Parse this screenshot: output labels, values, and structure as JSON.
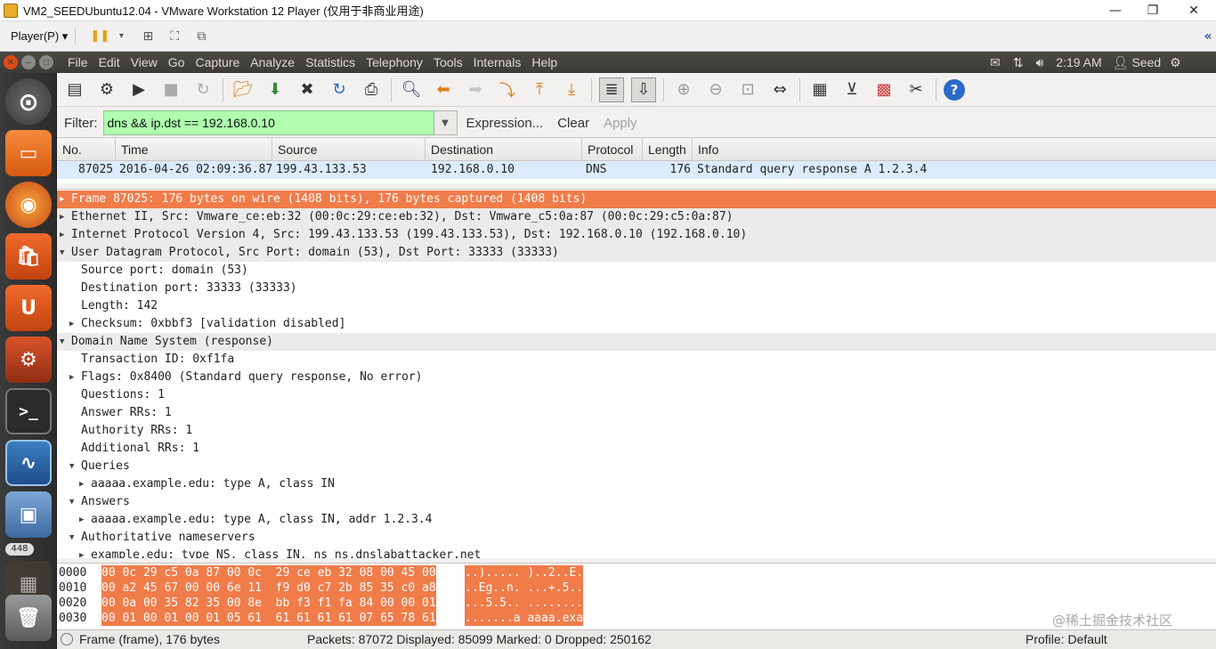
{
  "host_window": {
    "title": "VM2_SEEDUbuntu12.04 - VMware Workstation 12 Player (仅用于非商业用途)",
    "minimize": "—",
    "restore": "❐",
    "close": "✕"
  },
  "vmware_toolbar": {
    "player_menu": "Player(P) ▾",
    "pause_icon": "❚❚",
    "collapse_icon": "«"
  },
  "ubuntu_panel": {
    "menus": [
      "File",
      "Edit",
      "View",
      "Go",
      "Capture",
      "Analyze",
      "Statistics",
      "Telephony",
      "Tools",
      "Internals",
      "Help"
    ],
    "time": "2:19 AM",
    "user": "Seed"
  },
  "launcher": {
    "badge": "448"
  },
  "filter": {
    "label": "Filter:",
    "value": "dns && ip.dst == 192.168.0.10",
    "expression": "Expression...",
    "clear": "Clear",
    "apply": "Apply"
  },
  "packet_list": {
    "columns": [
      "No.",
      "Time",
      "Source",
      "Destination",
      "Protocol",
      "Length",
      "Info"
    ],
    "row": {
      "no": "87025",
      "time": "2016-04-26 02:09:36.87",
      "source": "199.43.133.53",
      "destination": "192.168.0.10",
      "protocol": "DNS",
      "length": "176",
      "info": "Standard query response A 1.2.3.4"
    }
  },
  "details": [
    {
      "text": "Frame 87025: 176 bytes on wire (1408 bits), 176 bytes captured (1408 bits)",
      "arrow": "▶"
    },
    {
      "text": "Ethernet II, Src: Vmware_ce:eb:32 (00:0c:29:ce:eb:32), Dst: Vmware_c5:0a:87 (00:0c:29:c5:0a:87)",
      "arrow": "▶"
    },
    {
      "text": "Internet Protocol Version 4, Src: 199.43.133.53 (199.43.133.53), Dst: 192.168.0.10 (192.168.0.10)",
      "arrow": "▶"
    },
    {
      "text": "User Datagram Protocol, Src Port: domain (53), Dst Port: 33333 (33333)",
      "arrow": "▼"
    },
    {
      "text": "Source port: domain (53)",
      "arrow": ""
    },
    {
      "text": "Destination port: 33333 (33333)",
      "arrow": ""
    },
    {
      "text": "Length: 142",
      "arrow": ""
    },
    {
      "text": "Checksum: 0xbbf3 [validation disabled]",
      "arrow": "▶"
    },
    {
      "text": "Domain Name System (response)",
      "arrow": "▼"
    },
    {
      "text": "Transaction ID: 0xf1fa",
      "arrow": ""
    },
    {
      "text": "Flags: 0x8400 (Standard query response, No error)",
      "arrow": "▶"
    },
    {
      "text": "Questions: 1",
      "arrow": ""
    },
    {
      "text": "Answer RRs: 1",
      "arrow": ""
    },
    {
      "text": "Authority RRs: 1",
      "arrow": ""
    },
    {
      "text": "Additional RRs: 1",
      "arrow": ""
    },
    {
      "text": "Queries",
      "arrow": "▼"
    },
    {
      "text": "aaaaa.example.edu: type A, class IN",
      "arrow": "▶"
    },
    {
      "text": "Answers",
      "arrow": "▼"
    },
    {
      "text": "aaaaa.example.edu: type A, class IN, addr 1.2.3.4",
      "arrow": "▶"
    },
    {
      "text": "Authoritative nameservers",
      "arrow": "▼"
    },
    {
      "text": "example.edu: type NS, class IN, ns ns.dnslabattacker.net",
      "arrow": "▶"
    }
  ],
  "bytes": [
    {
      "offset": "0000",
      "hex": "00 0c 29 c5 0a 87 00 0c  29 ce eb 32 08 00 45 00",
      "ascii": "..)..... )..2..E."
    },
    {
      "offset": "0010",
      "hex": "00 a2 45 67 00 00 6e 11  f9 d0 c7 2b 85 35 c0 a8",
      "ascii": "..Eg..n. ...+.5.."
    },
    {
      "offset": "0020",
      "hex": "00 0a 00 35 82 35 00 8e  bb f3 f1 fa 84 00 00 01",
      "ascii": "...5.5.. ........"
    },
    {
      "offset": "0030",
      "hex": "00 01 00 01 00 01 05 61  61 61 61 61 07 65 78 61",
      "ascii": ".......a aaaa.exa"
    }
  ],
  "statusbar": {
    "frame": "Frame (frame), 176 bytes",
    "packets": "Packets: 87072 Displayed: 85099 Marked: 0 Dropped: 250162",
    "profile": "Profile: Default"
  },
  "watermark": "@稀土掘金技术社区"
}
